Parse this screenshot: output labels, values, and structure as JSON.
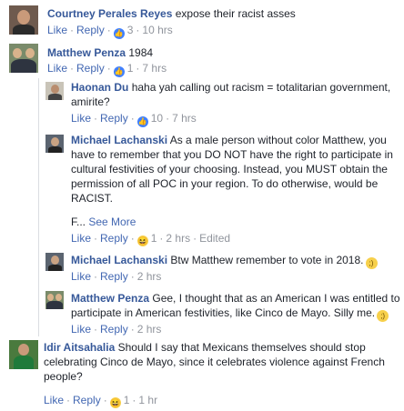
{
  "actions": {
    "like": "Like",
    "reply": "Reply",
    "see_more": "See More",
    "edited": "Edited",
    "dot": "·"
  },
  "comments": [
    {
      "name": "Courtney Perales Reyes",
      "text": "expose their racist asses",
      "reaction_icon": "like-icon",
      "reaction_count": "3",
      "time": "10 hrs"
    },
    {
      "name": "Matthew Penza",
      "text": "1984",
      "reaction_icon": "like-icon",
      "reaction_count": "1",
      "time": "7 hrs"
    },
    {
      "name": "Haonan Du",
      "text": "haha yah calling out racism = totalitarian government, amirite?",
      "reaction_icon": "like-icon",
      "reaction_count": "10",
      "time": "7 hrs"
    },
    {
      "name": "Michael Lachanski",
      "text": "As a male person without color Matthew, you have to remember that you DO NOT have the right to participate in cultural festivities of your choosing. Instead, you MUST obtain the permission of all POC in your region. To do otherwise, would be RACIST.",
      "truncated": "F...",
      "reaction_icon": "haha-icon",
      "reaction_count": "1",
      "time": "2 hrs"
    },
    {
      "name": "Michael Lachanski",
      "text": "Btw Matthew remember to vote in 2018.",
      "emoji_icon": "wink-emoji-icon",
      "time": "2 hrs"
    },
    {
      "name": "Matthew Penza",
      "text": "Gee, I thought that as an American I was entitled to participate in American festivities, like Cinco de Mayo. Silly me.",
      "emoji_icon": "wink-emoji-icon",
      "time": "2 hrs"
    },
    {
      "name": "Idir Aitsahalia",
      "text": "Should I say that Mexicans themselves should stop celebrating Cinco de Mayo, since it celebrates violence against French people?",
      "reaction_icon": "haha-icon",
      "reaction_count": "1",
      "time": "1 hr"
    }
  ],
  "colors": {
    "name": "#365899",
    "link": "#4267b2",
    "meta": "#90949c",
    "text": "#1d2129"
  }
}
